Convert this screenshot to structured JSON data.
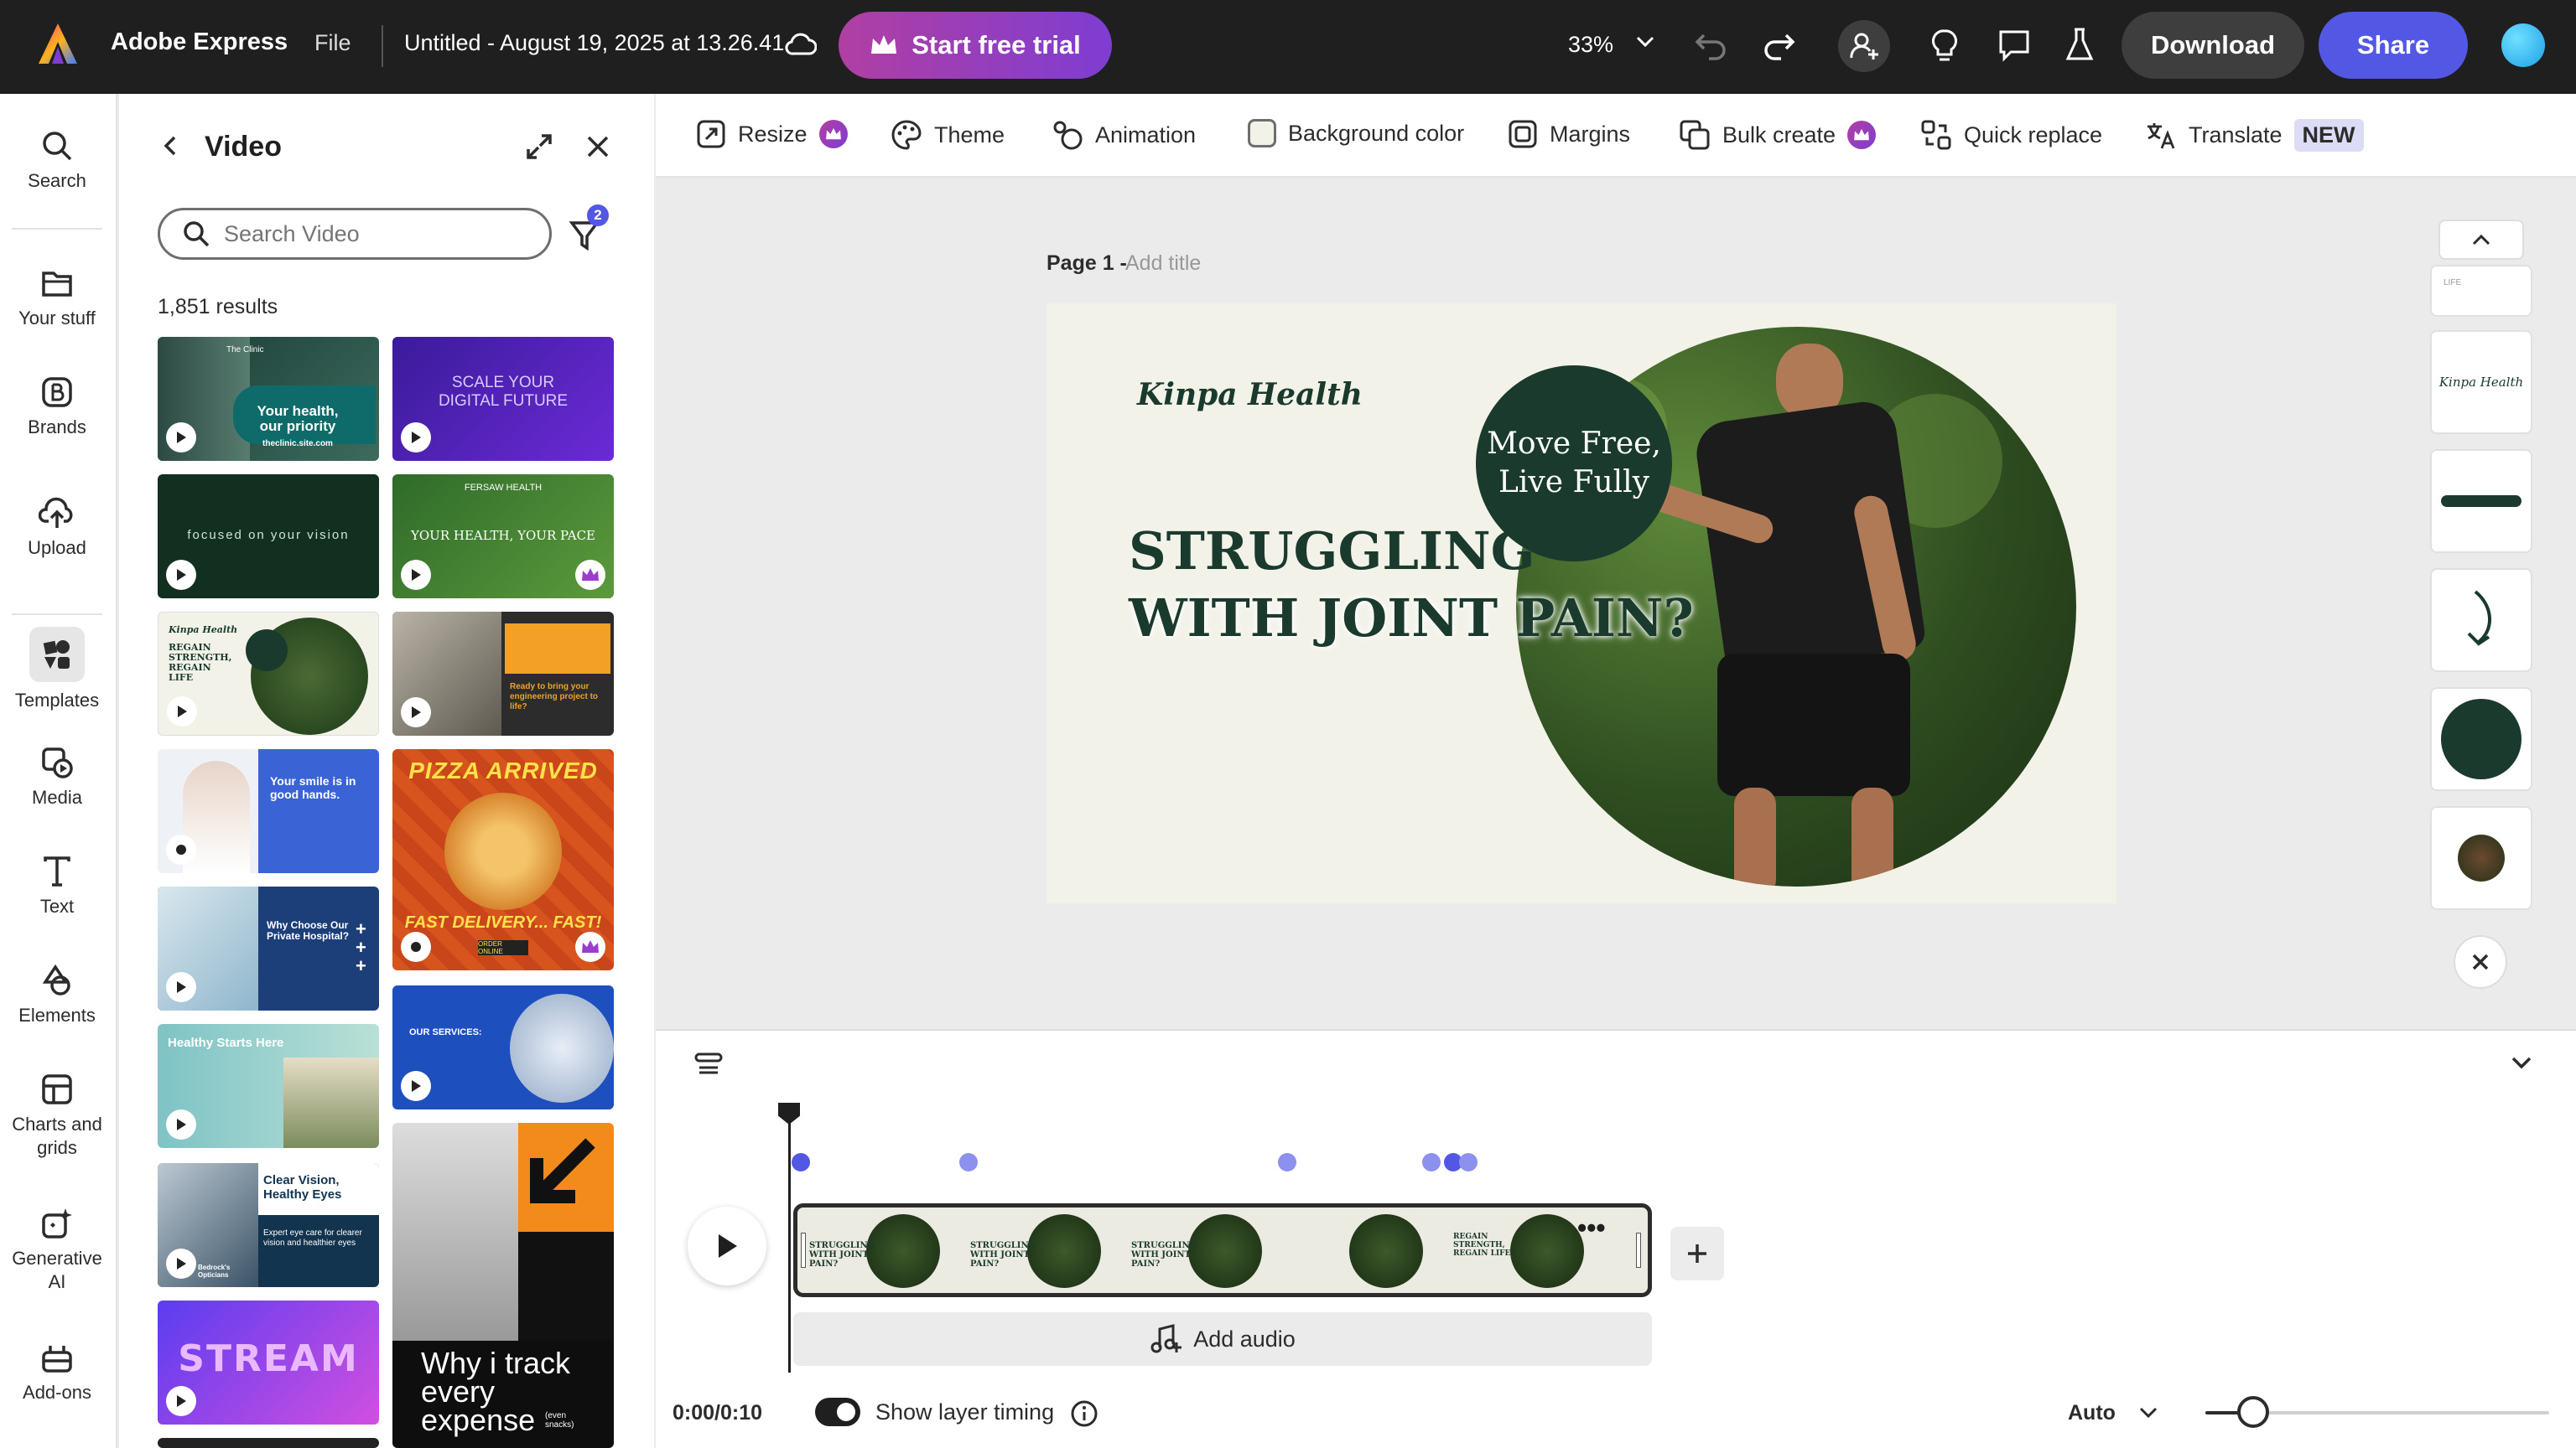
{
  "topbar": {
    "app_name": "Adobe Express",
    "file_menu": "File",
    "doc_title": "Untitled - August 19, 2025 at 13.26.41",
    "trial_label": "Start free trial",
    "zoom": "33%",
    "download_label": "Download",
    "share_label": "Share"
  },
  "rail": {
    "items": [
      {
        "label": "Search",
        "icon": "search-icon"
      },
      {
        "label": "Your stuff",
        "icon": "folder-icon"
      },
      {
        "label": "Brands",
        "icon": "brand-icon"
      },
      {
        "label": "Upload",
        "icon": "upload-icon"
      },
      {
        "label": "Templates",
        "icon": "templates-icon"
      },
      {
        "label": "Media",
        "icon": "media-icon"
      },
      {
        "label": "Text",
        "icon": "text-icon"
      },
      {
        "label": "Elements",
        "icon": "elements-icon"
      },
      {
        "label": "Charts and grids",
        "icon": "charts-icon"
      },
      {
        "label": "Generative AI",
        "icon": "sparkle-icon"
      },
      {
        "label": "Add-ons",
        "icon": "addons-icon"
      }
    ]
  },
  "panel": {
    "title": "Video",
    "search_placeholder": "Search Video",
    "filter_count": "2",
    "results": "1,851 results",
    "thumbs": [
      {
        "t1": "Your health,",
        "t2": "our priority",
        "t3": "theclinic.site.com",
        "t4": "The Clinic"
      },
      {
        "t1": "SCALE YOUR",
        "t2": "DIGITAL FUTURE"
      },
      {
        "t1": "focused on your vision"
      },
      {
        "t1": "YOUR HEALTH, YOUR PACE",
        "t2": "FERSAW HEALTH"
      },
      {
        "t1": "Kinpa Health",
        "t2": "REGAIN STRENGTH, REGAIN LIFE"
      },
      {
        "t1": "Ready to bring your engineering project to life?"
      },
      {
        "t1": "Your smile is in good hands."
      },
      {
        "t1": "PIZZA ARRIVED",
        "t2": "FAST DELIVERY... FAST!",
        "t3": "ORDER ONLINE"
      },
      {
        "t1": "Why Choose Our Private Hospital?"
      },
      {
        "t1": "OUR SERVICES:"
      },
      {
        "t1": "Healthy Starts Here"
      },
      {
        "t1": "Why i track every expense",
        "t2": "(even snacks)"
      },
      {
        "t1": "Clear Vision, Healthy Eyes",
        "t2": "Expert eye care for clearer vision and healthier eyes",
        "t3": "Bedrock's Opticians"
      },
      {
        "t1": "STREAM"
      }
    ]
  },
  "toolbar": {
    "resize": "Resize",
    "theme": "Theme",
    "animation": "Animation",
    "background": "Background color",
    "margins": "Margins",
    "bulk": "Bulk create",
    "quick_replace": "Quick replace",
    "translate": "Translate",
    "new_badge": "NEW"
  },
  "canvas": {
    "page_label": "Page 1 -",
    "add_title": "Add title",
    "brand": "Kinpa Health",
    "badge_line1": "Move Free,",
    "badge_line2": "Live Fully",
    "headline1": "STRUGGLING",
    "headline2": "WITH JOINT PAIN?"
  },
  "side_thumbs": {
    "top_label": "LIFE",
    "brand_label": "Kinpa Health"
  },
  "timeline": {
    "add_audio": "Add audio",
    "time": "0:00/0:10",
    "layer_timing": "Show layer timing",
    "auto": "Auto",
    "clip_text1": "STRUGGLING WITH JOINT PAIN?",
    "clip_text2": "REGAIN STRENGTH, REGAIN LIFE"
  },
  "colors": {
    "accent": "#5258e4",
    "dark_green": "#1b3a2e",
    "trial_gradient_start": "#b13fa2",
    "trial_gradient_end": "#7e3dd2"
  }
}
